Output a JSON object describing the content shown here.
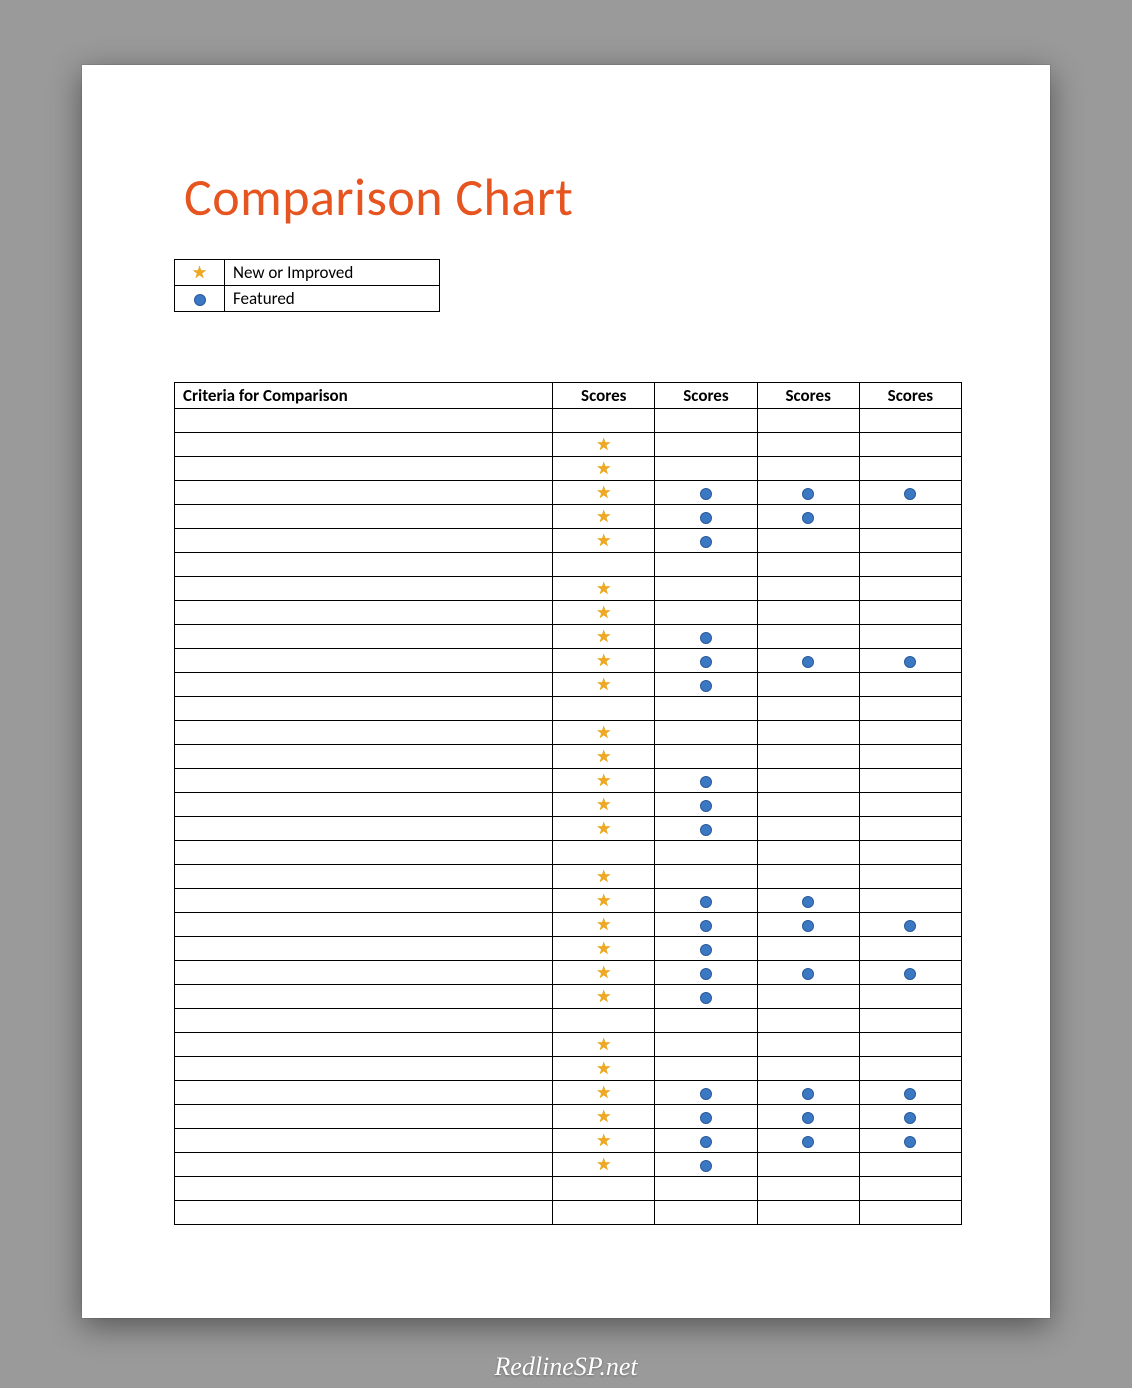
{
  "title": "Comparison Chart",
  "legend": [
    {
      "icon": "star",
      "label": "New or Improved"
    },
    {
      "icon": "dot",
      "label": "Featured"
    }
  ],
  "headers": {
    "criteria": "Criteria for Comparison",
    "scores": [
      "Scores",
      "Scores",
      "Scores",
      "Scores"
    ]
  },
  "chart_data": {
    "type": "table",
    "icon_meaning": {
      "star": "New or Improved",
      "dot": "Featured"
    },
    "columns": [
      "Criteria",
      "Score 1",
      "Score 2",
      "Score 3",
      "Score 4"
    ],
    "rows": [
      {
        "criteria": "",
        "cells": [
          "",
          "",
          "",
          ""
        ]
      },
      {
        "criteria": "",
        "cells": [
          "star",
          "",
          "",
          ""
        ]
      },
      {
        "criteria": "",
        "cells": [
          "star",
          "",
          "",
          ""
        ]
      },
      {
        "criteria": "",
        "cells": [
          "star",
          "dot",
          "dot",
          "dot"
        ]
      },
      {
        "criteria": "",
        "cells": [
          "star",
          "dot",
          "dot",
          ""
        ]
      },
      {
        "criteria": "",
        "cells": [
          "star",
          "dot",
          "",
          ""
        ]
      },
      {
        "criteria": "",
        "cells": [
          "",
          "",
          "",
          ""
        ]
      },
      {
        "criteria": "",
        "cells": [
          "star",
          "",
          "",
          ""
        ]
      },
      {
        "criteria": "",
        "cells": [
          "star",
          "",
          "",
          ""
        ]
      },
      {
        "criteria": "",
        "cells": [
          "star",
          "dot",
          "",
          ""
        ]
      },
      {
        "criteria": "",
        "cells": [
          "star",
          "dot",
          "dot",
          "dot"
        ]
      },
      {
        "criteria": "",
        "cells": [
          "star",
          "dot",
          "",
          ""
        ]
      },
      {
        "criteria": "",
        "cells": [
          "",
          "",
          "",
          ""
        ]
      },
      {
        "criteria": "",
        "cells": [
          "star",
          "",
          "",
          ""
        ]
      },
      {
        "criteria": "",
        "cells": [
          "star",
          "",
          "",
          ""
        ]
      },
      {
        "criteria": "",
        "cells": [
          "star",
          "dot",
          "",
          ""
        ]
      },
      {
        "criteria": "",
        "cells": [
          "star",
          "dot",
          "",
          ""
        ]
      },
      {
        "criteria": "",
        "cells": [
          "star",
          "dot",
          "",
          ""
        ]
      },
      {
        "criteria": "",
        "cells": [
          "",
          "",
          "",
          ""
        ]
      },
      {
        "criteria": "",
        "cells": [
          "star",
          "",
          "",
          ""
        ]
      },
      {
        "criteria": "",
        "cells": [
          "star",
          "dot",
          "dot",
          ""
        ]
      },
      {
        "criteria": "",
        "cells": [
          "star",
          "dot",
          "dot",
          "dot"
        ]
      },
      {
        "criteria": "",
        "cells": [
          "star",
          "dot",
          "",
          ""
        ]
      },
      {
        "criteria": "",
        "cells": [
          "star",
          "dot",
          "dot",
          "dot"
        ]
      },
      {
        "criteria": "",
        "cells": [
          "star",
          "dot",
          "",
          ""
        ]
      },
      {
        "criteria": "",
        "cells": [
          "",
          "",
          "",
          ""
        ]
      },
      {
        "criteria": "",
        "cells": [
          "star",
          "",
          "",
          ""
        ]
      },
      {
        "criteria": "",
        "cells": [
          "star",
          "",
          "",
          ""
        ]
      },
      {
        "criteria": "",
        "cells": [
          "star",
          "dot",
          "dot",
          "dot"
        ]
      },
      {
        "criteria": "",
        "cells": [
          "star",
          "dot",
          "dot",
          "dot"
        ]
      },
      {
        "criteria": "",
        "cells": [
          "star",
          "dot",
          "dot",
          "dot"
        ]
      },
      {
        "criteria": "",
        "cells": [
          "star",
          "dot",
          "",
          ""
        ]
      },
      {
        "criteria": "",
        "cells": [
          "",
          "",
          "",
          ""
        ]
      },
      {
        "criteria": "",
        "cells": [
          "",
          "",
          "",
          ""
        ]
      }
    ]
  },
  "watermark": "RedlineSP.net"
}
